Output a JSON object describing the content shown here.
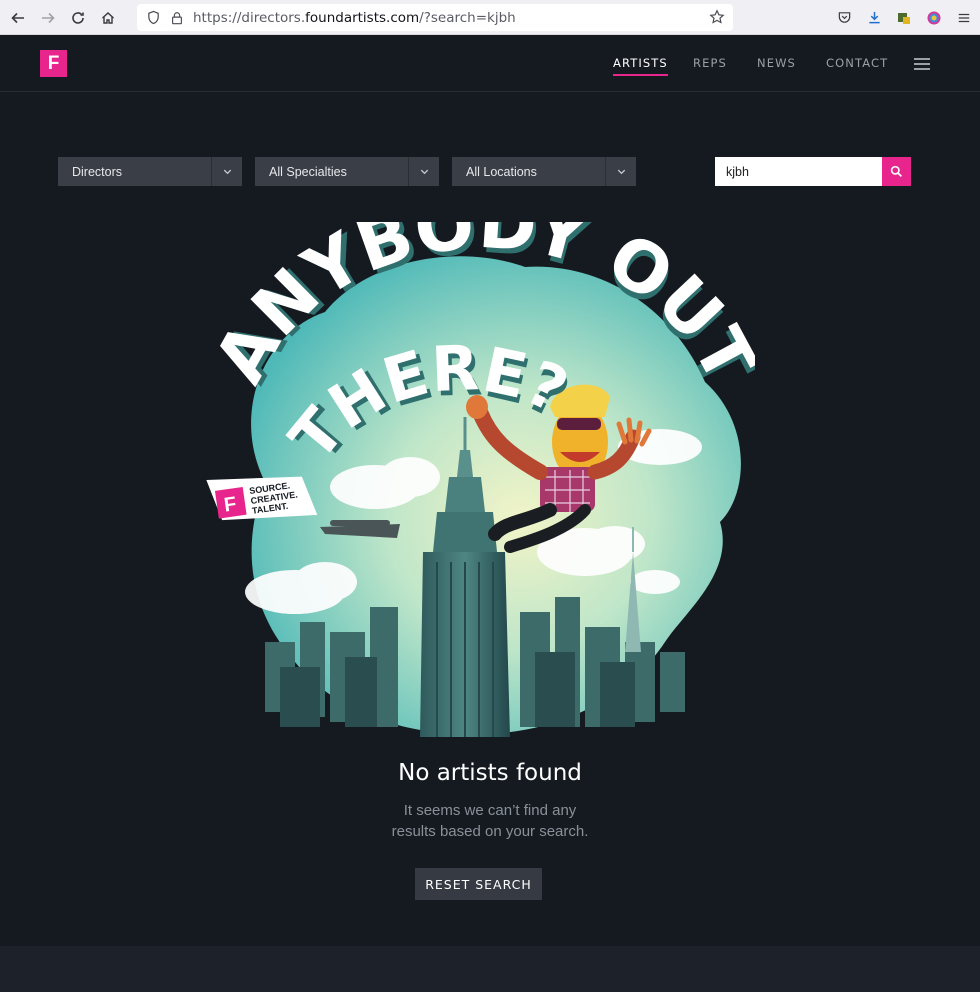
{
  "browser": {
    "url_prefix": "https://directors.",
    "url_host": "foundartists.com",
    "url_suffix": "/?search=kjbh"
  },
  "header": {
    "logo_letter": "F",
    "nav": [
      "ARTISTS",
      "REPS",
      "NEWS",
      "CONTACT"
    ],
    "active_nav": "ARTISTS"
  },
  "filters": {
    "category": "Directors",
    "specialty": "All Specialties",
    "location": "All Locations",
    "search_value": "kjbh"
  },
  "illustration": {
    "headline_line1": "ANYBODY OUT",
    "headline_line2": "THERE?",
    "banner_letter": "F",
    "banner_text": [
      "SOURCE.",
      "CREATIVE.",
      "TALENT."
    ]
  },
  "empty_state": {
    "title": "No artists found",
    "message_line1": "It seems we can’t find any",
    "message_line2": "results based on your search.",
    "reset_label": "RESET SEARCH"
  },
  "colors": {
    "accent": "#e8248d",
    "background": "#151a21",
    "filter_bg": "#3a3f47"
  }
}
